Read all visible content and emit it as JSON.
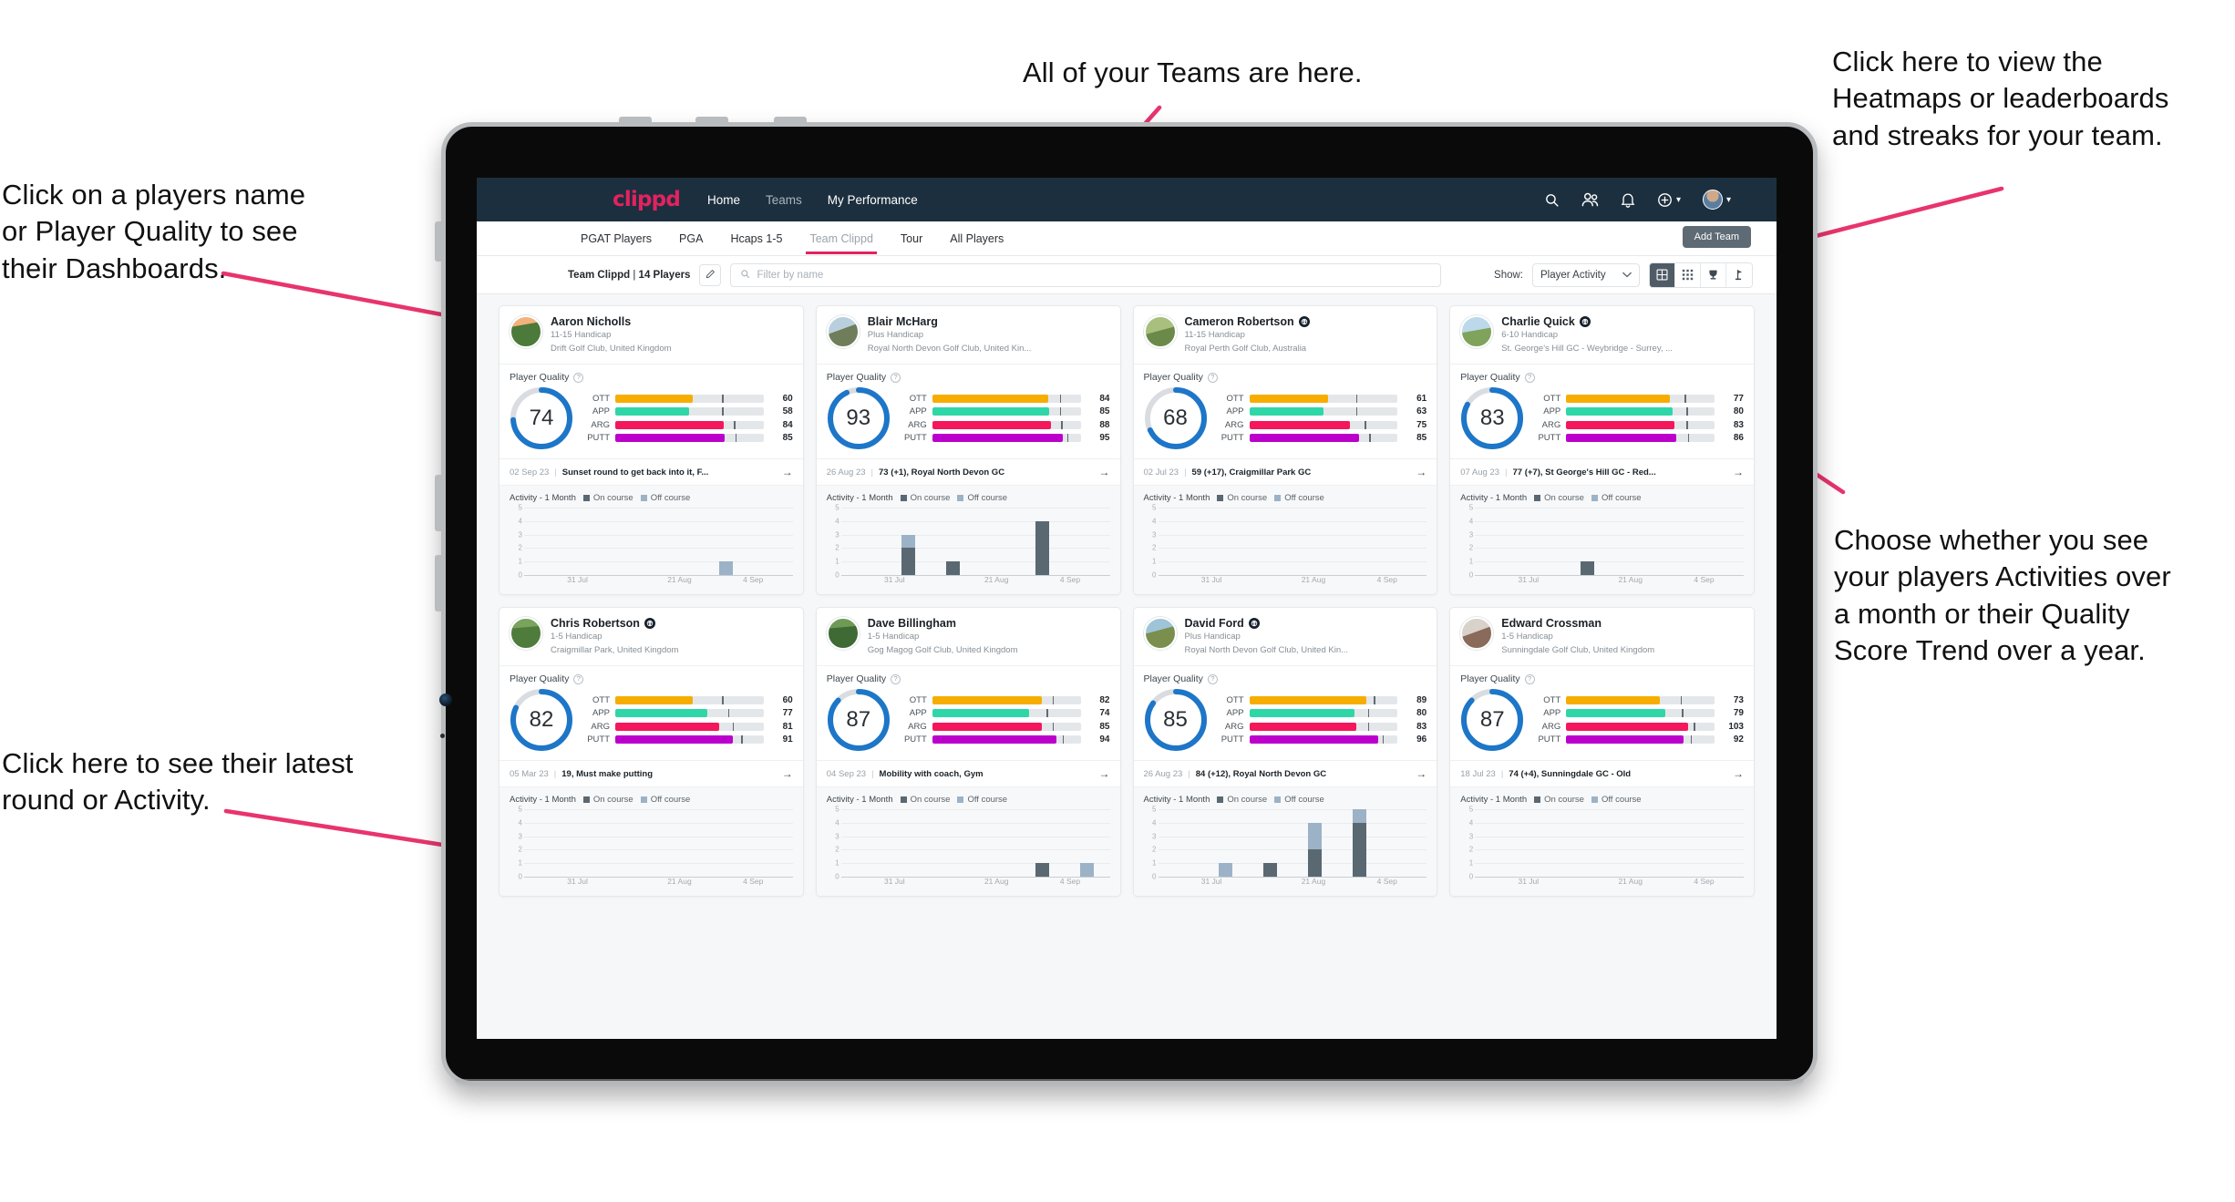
{
  "annotations": {
    "top": "All of your Teams are here.",
    "top_right": "Click here to view the\nHeatmaps or leaderboards\nand streaks for your team.",
    "left": "Click on a players name\nor Player Quality to see\ntheir Dashboards.",
    "right": "Choose whether you see\nyour players Activities over\na month or their Quality\nScore Trend over a year.",
    "bottom": "Click here to see their latest\nround or Activity.",
    "arrow_color": "#e8346d"
  },
  "topnav": {
    "brand": "clippd",
    "links": [
      {
        "label": "Home",
        "active": true
      },
      {
        "label": "Teams",
        "active": false
      },
      {
        "label": "My Performance",
        "active": true
      }
    ],
    "icons": [
      "search-icon",
      "people-icon",
      "bell-icon",
      "plus-circle-icon",
      "avatar"
    ]
  },
  "tabs": [
    {
      "label": "PGAT Players",
      "state": "normal"
    },
    {
      "label": "PGA",
      "state": "normal"
    },
    {
      "label": "Hcaps 1-5",
      "state": "normal"
    },
    {
      "label": "Team Clippd",
      "state": "active"
    },
    {
      "label": "Tour",
      "state": "normal"
    },
    {
      "label": "All Players",
      "state": "normal"
    }
  ],
  "add_team_label": "Add Team",
  "toolbar": {
    "team_name": "Team Clippd",
    "team_count": "14 Players",
    "edit_icon": "pencil-icon",
    "search_placeholder": "Filter by name",
    "search_value": "",
    "show_label": "Show:",
    "show_value": "Player Activity",
    "view_modes": [
      {
        "name": "grid-large-icon",
        "active": true
      },
      {
        "name": "grid-small-icon",
        "active": false
      },
      {
        "name": "trophy-icon",
        "active": false
      },
      {
        "name": "flag-icon",
        "active": false
      }
    ]
  },
  "card_labels": {
    "player_quality": "Player Quality",
    "activity": "Activity - 1 Month",
    "legend_on": "On course",
    "legend_off": "Off course",
    "metrics": [
      "OTT",
      "APP",
      "ARG",
      "PUTT"
    ],
    "x_ticks": [
      "31 Jul",
      "21 Aug",
      "4 Sep"
    ],
    "y_ticks": [
      "5",
      "4",
      "3",
      "2",
      "1",
      "0"
    ]
  },
  "colors": {
    "ott": "#f6ad00",
    "app": "#2fd6a8",
    "arg": "#f5175c",
    "putt": "#bb00cc",
    "ring": "#1d76c8",
    "ring_track": "#d9dde1",
    "on_course": "#5a6872",
    "off_course": "#9cb2c6",
    "brand": "#e3225f",
    "nav_bg": "#1c2f3f"
  },
  "players": [
    {
      "name": "Aaron Nicholls",
      "verified": false,
      "handicap": "11-15 Handicap",
      "club": "Drift Golf Club, United Kingdom",
      "score": 74,
      "avatar": "linear-gradient(170deg,#f2b27c 0 28%,#4c7a3a 29% 100%)",
      "metrics": [
        {
          "key": "OTT",
          "value": 60,
          "fill": 52,
          "tick": 72
        },
        {
          "key": "APP",
          "value": 58,
          "fill": 50,
          "tick": 72
        },
        {
          "key": "ARG",
          "value": 84,
          "fill": 73,
          "tick": 80
        },
        {
          "key": "PUTT",
          "value": 85,
          "fill": 74,
          "tick": 81
        }
      ],
      "round_date": "02 Sep 23",
      "round_text": "Sunset round to get back into it, F...",
      "activity": [
        {
          "on": 0,
          "off": 0
        },
        {
          "on": 0,
          "off": 0
        },
        {
          "on": 0,
          "off": 0
        },
        {
          "on": 0,
          "off": 0
        },
        {
          "on": 0,
          "off": 1
        },
        {
          "on": 0,
          "off": 0
        }
      ]
    },
    {
      "name": "Blair McHarg",
      "verified": false,
      "handicap": "Plus Handicap",
      "club": "Royal North Devon Golf Club, United Kin...",
      "score": 93,
      "avatar": "linear-gradient(160deg,#b9cfdd 0 42%,#6f7d5a 43% 100%)",
      "metrics": [
        {
          "key": "OTT",
          "value": 84,
          "fill": 78,
          "tick": 86
        },
        {
          "key": "APP",
          "value": 85,
          "fill": 79,
          "tick": 86
        },
        {
          "key": "ARG",
          "value": 88,
          "fill": 80,
          "tick": 87
        },
        {
          "key": "PUTT",
          "value": 95,
          "fill": 88,
          "tick": 91
        }
      ],
      "round_date": "26 Aug 23",
      "round_text": "73 (+1), Royal North Devon GC",
      "activity": [
        {
          "on": 0,
          "off": 0
        },
        {
          "on": 2,
          "off": 1
        },
        {
          "on": 1,
          "off": 0
        },
        {
          "on": 0,
          "off": 0
        },
        {
          "on": 4,
          "off": 0
        },
        {
          "on": 0,
          "off": 0
        }
      ]
    },
    {
      "name": "Cameron Robertson",
      "verified": true,
      "handicap": "11-15 Handicap",
      "club": "Royal Perth Golf Club, Australia",
      "score": 68,
      "avatar": "linear-gradient(165deg,#a8bf7e 0 46%,#6b8a4a 47% 100%)",
      "metrics": [
        {
          "key": "OTT",
          "value": 61,
          "fill": 53,
          "tick": 72
        },
        {
          "key": "APP",
          "value": 63,
          "fill": 50,
          "tick": 72
        },
        {
          "key": "ARG",
          "value": 75,
          "fill": 68,
          "tick": 78
        },
        {
          "key": "PUTT",
          "value": 85,
          "fill": 74,
          "tick": 81
        }
      ],
      "round_date": "02 Jul 23",
      "round_text": "59 (+17), Craigmillar Park GC",
      "activity": [
        {
          "on": 0,
          "off": 0
        },
        {
          "on": 0,
          "off": 0
        },
        {
          "on": 0,
          "off": 0
        },
        {
          "on": 0,
          "off": 0
        },
        {
          "on": 0,
          "off": 0
        },
        {
          "on": 0,
          "off": 0
        }
      ]
    },
    {
      "name": "Charlie Quick",
      "verified": true,
      "handicap": "6-10 Handicap",
      "club": "St. George's Hill GC - Weybridge - Surrey, ...",
      "score": 83,
      "avatar": "linear-gradient(170deg,#bcd8ea 0 45%,#7fa35a 46% 100%)",
      "metrics": [
        {
          "key": "OTT",
          "value": 77,
          "fill": 70,
          "tick": 80
        },
        {
          "key": "APP",
          "value": 80,
          "fill": 72,
          "tick": 81
        },
        {
          "key": "ARG",
          "value": 83,
          "fill": 73,
          "tick": 81
        },
        {
          "key": "PUTT",
          "value": 86,
          "fill": 74,
          "tick": 82
        }
      ],
      "round_date": "07 Aug 23",
      "round_text": "77 (+7), St George's Hill GC - Red...",
      "activity": [
        {
          "on": 0,
          "off": 0
        },
        {
          "on": 0,
          "off": 0
        },
        {
          "on": 1,
          "off": 0
        },
        {
          "on": 0,
          "off": 0
        },
        {
          "on": 0,
          "off": 0
        },
        {
          "on": 0,
          "off": 0
        }
      ]
    },
    {
      "name": "Chris Robertson",
      "verified": true,
      "handicap": "1-5 Handicap",
      "club": "Craigmillar Park, United Kingdom",
      "score": 82,
      "avatar": "linear-gradient(175deg,#7aa35c 0 30%,#4f7b3c 31% 100%)",
      "metrics": [
        {
          "key": "OTT",
          "value": 60,
          "fill": 52,
          "tick": 72
        },
        {
          "key": "APP",
          "value": 77,
          "fill": 62,
          "tick": 76
        },
        {
          "key": "ARG",
          "value": 81,
          "fill": 70,
          "tick": 79
        },
        {
          "key": "PUTT",
          "value": 91,
          "fill": 79,
          "tick": 85
        }
      ],
      "round_date": "05 Mar 23",
      "round_text": "19, Must make putting",
      "activity": [
        {
          "on": 0,
          "off": 0
        },
        {
          "on": 0,
          "off": 0
        },
        {
          "on": 0,
          "off": 0
        },
        {
          "on": 0,
          "off": 0
        },
        {
          "on": 0,
          "off": 0
        },
        {
          "on": 0,
          "off": 0
        }
      ]
    },
    {
      "name": "Dave Billingham",
      "verified": false,
      "handicap": "1-5 Handicap",
      "club": "Gog Magog Golf Club, United Kingdom",
      "score": 87,
      "avatar": "linear-gradient(175deg,#6f9a55 0 30%,#3f6a33 31% 100%)",
      "metrics": [
        {
          "key": "OTT",
          "value": 82,
          "fill": 74,
          "tick": 81
        },
        {
          "key": "APP",
          "value": 74,
          "fill": 65,
          "tick": 77
        },
        {
          "key": "ARG",
          "value": 85,
          "fill": 74,
          "tick": 81
        },
        {
          "key": "PUTT",
          "value": 94,
          "fill": 84,
          "tick": 88
        }
      ],
      "round_date": "04 Sep 23",
      "round_text": "Mobility with coach, Gym",
      "activity": [
        {
          "on": 0,
          "off": 0
        },
        {
          "on": 0,
          "off": 0
        },
        {
          "on": 0,
          "off": 0
        },
        {
          "on": 0,
          "off": 0
        },
        {
          "on": 1,
          "off": 0
        },
        {
          "on": 0,
          "off": 1
        }
      ]
    },
    {
      "name": "David Ford",
      "verified": true,
      "handicap": "Plus Handicap",
      "club": "Royal North Devon Golf Club, United Kin...",
      "score": 85,
      "avatar": "linear-gradient(165deg,#9fc4d8 0 40%,#7a8f4e 41% 100%)",
      "metrics": [
        {
          "key": "OTT",
          "value": 89,
          "fill": 79,
          "tick": 84
        },
        {
          "key": "APP",
          "value": 80,
          "fill": 71,
          "tick": 80
        },
        {
          "key": "ARG",
          "value": 83,
          "fill": 72,
          "tick": 80
        },
        {
          "key": "PUTT",
          "value": 96,
          "fill": 87,
          "tick": 90
        }
      ],
      "round_date": "26 Aug 23",
      "round_text": "84 (+12), Royal North Devon GC",
      "activity": [
        {
          "on": 0,
          "off": 0
        },
        {
          "on": 0,
          "off": 1
        },
        {
          "on": 1,
          "off": 0
        },
        {
          "on": 2,
          "off": 2
        },
        {
          "on": 4,
          "off": 1
        },
        {
          "on": 0,
          "off": 0
        }
      ]
    },
    {
      "name": "Edward Crossman",
      "verified": false,
      "handicap": "1-5 Handicap",
      "club": "Sunningdale Golf Club, United Kingdom",
      "score": 87,
      "avatar": "linear-gradient(160deg,#d8d2cb 0 45%,#8a6a5a 46% 100%)",
      "metrics": [
        {
          "key": "OTT",
          "value": 73,
          "fill": 63,
          "tick": 77
        },
        {
          "key": "APP",
          "value": 79,
          "fill": 67,
          "tick": 78
        },
        {
          "key": "ARG",
          "value": 103,
          "fill": 82,
          "tick": 86
        },
        {
          "key": "PUTT",
          "value": 92,
          "fill": 79,
          "tick": 84
        }
      ],
      "round_date": "18 Jul 23",
      "round_text": "74 (+4), Sunningdale GC - Old",
      "activity": [
        {
          "on": 0,
          "off": 0
        },
        {
          "on": 0,
          "off": 0
        },
        {
          "on": 0,
          "off": 0
        },
        {
          "on": 0,
          "off": 0
        },
        {
          "on": 0,
          "off": 0
        },
        {
          "on": 0,
          "off": 0
        }
      ]
    }
  ]
}
